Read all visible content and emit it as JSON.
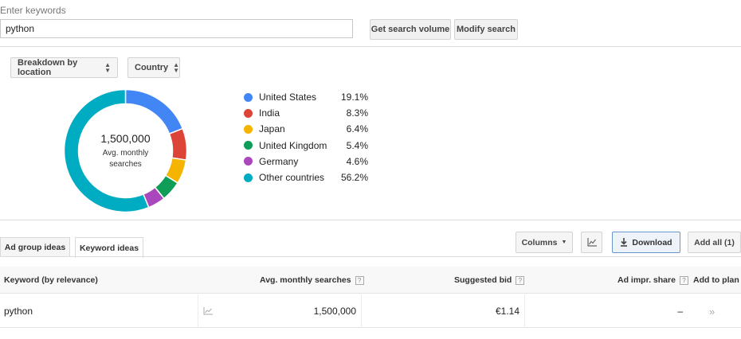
{
  "search": {
    "label": "Enter keywords",
    "value": "python",
    "get_volume_label": "Get search volume",
    "modify_label": "Modify search"
  },
  "breakdown": {
    "type_label": "Breakdown by location",
    "level_label": "Country"
  },
  "donut": {
    "total": "1,500,000",
    "subtitle": "Avg. monthly searches"
  },
  "chart_data": {
    "type": "pie",
    "categories": [
      "United States",
      "India",
      "Japan",
      "United Kingdom",
      "Germany",
      "Other countries"
    ],
    "values": [
      19.1,
      8.3,
      6.4,
      5.4,
      4.6,
      56.2
    ],
    "labels": [
      "19.1%",
      "8.3%",
      "6.4%",
      "5.4%",
      "4.6%",
      "56.2%"
    ],
    "colors": [
      "#4285f4",
      "#db4437",
      "#f4b400",
      "#0f9d58",
      "#ab47bc",
      "#00acc1"
    ],
    "legend_position": "right"
  },
  "tabs": [
    {
      "label": "Ad group ideas",
      "active": false
    },
    {
      "label": "Keyword ideas",
      "active": true
    }
  ],
  "toolbar": {
    "columns_label": "Columns",
    "download_label": "Download",
    "add_all_label": "Add all (1)",
    "download_icon": "download-icon",
    "chart_icon": "trend-chart-icon"
  },
  "table": {
    "headers": {
      "keyword": "Keyword (by relevance)",
      "avg_searches": "Avg. monthly searches",
      "suggested_bid": "Suggested bid",
      "ad_impr_share": "Ad impr. share",
      "add_to_plan": "Add to plan"
    },
    "help_glyph": "?",
    "rows": [
      {
        "keyword": "python",
        "avg_searches": "1,500,000",
        "suggested_bid": "€1.14",
        "ad_impr_share": "–",
        "add_glyph": "»"
      }
    ]
  }
}
